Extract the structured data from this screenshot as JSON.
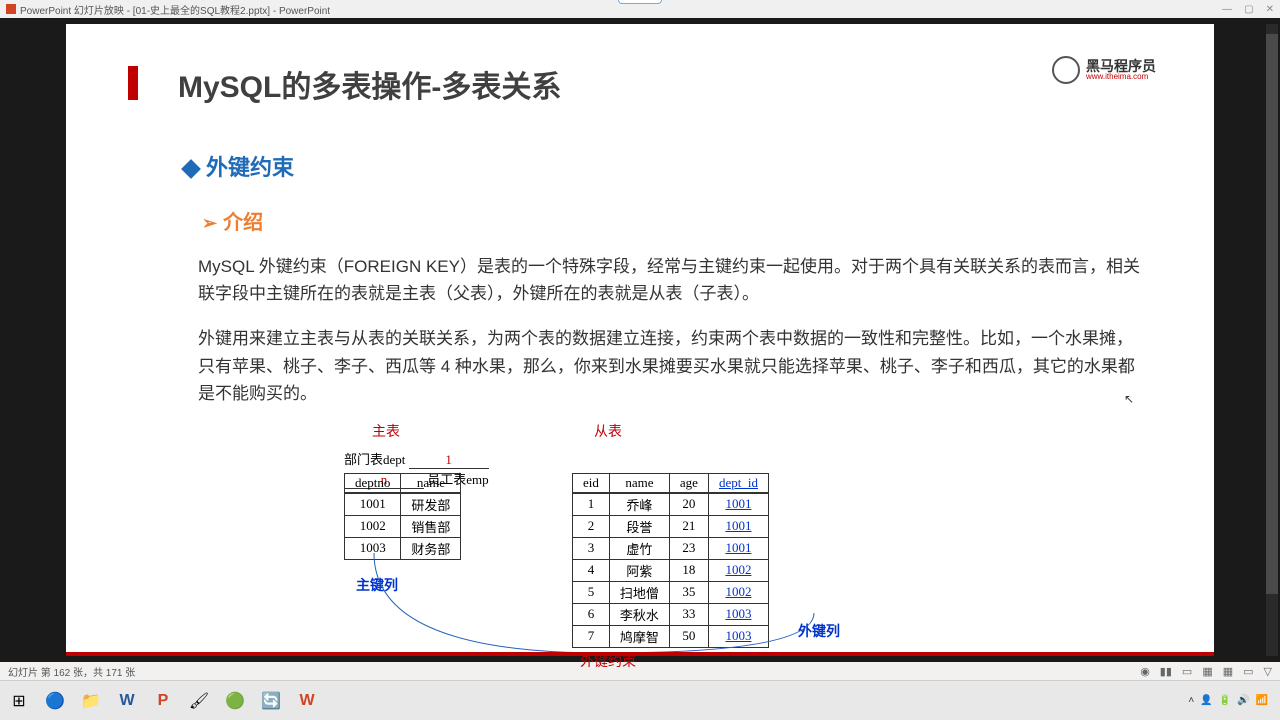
{
  "window": {
    "app_name": "PowerPoint 幻灯片放映 - [01-史上最全的SQL教程2.pptx] - PowerPoint"
  },
  "logo": {
    "cn": "黑马程序员",
    "url": "www.itheima.com"
  },
  "slide": {
    "title": "MySQL的多表操作-多表关系",
    "section1": "外键约束",
    "section2": "介绍",
    "para1": "MySQL 外键约束（FOREIGN KEY）是表的一个特殊字段，经常与主键约束一起使用。对于两个具有关联关系的表而言，相关联字段中主键所在的表就是主表（父表），外键所在的表就是从表（子表）。",
    "para2": "外键用来建立主表与从表的关联关系，为两个表的数据建立连接，约束两个表中数据的一致性和完整性。比如，一个水果摊，只有苹果、桃子、李子、西瓜等 4 种水果，那么，你来到水果摊要买水果就只能选择苹果、桃子、李子和西瓜，其它的水果都是不能购买的。"
  },
  "diagram": {
    "master_label": "主表",
    "slave_label": "从表",
    "dept_label": "部门表dept",
    "emp_label": "员工表emp",
    "one": "1",
    "n": "n",
    "pk_col_label": "主键列",
    "fk_col_label": "外键列",
    "fk_constraint_label": "外键约束",
    "dept_headers": [
      "deptno",
      "name"
    ],
    "dept_rows": [
      [
        "1001",
        "研发部"
      ],
      [
        "1002",
        "销售部"
      ],
      [
        "1003",
        "财务部"
      ]
    ],
    "emp_headers": [
      "eid",
      "name",
      "age",
      "dept_id"
    ],
    "emp_rows": [
      [
        "1",
        "乔峰",
        "20",
        "1001"
      ],
      [
        "2",
        "段誉",
        "21",
        "1001"
      ],
      [
        "3",
        "虚竹",
        "23",
        "1001"
      ],
      [
        "4",
        "阿紫",
        "18",
        "1002"
      ],
      [
        "5",
        "扫地僧",
        "35",
        "1002"
      ],
      [
        "6",
        "李秋水",
        "33",
        "1003"
      ],
      [
        "7",
        "鸠摩智",
        "50",
        "1003"
      ]
    ]
  },
  "status": {
    "slide_info": "幻灯片 第 162 张，共 171 张"
  }
}
